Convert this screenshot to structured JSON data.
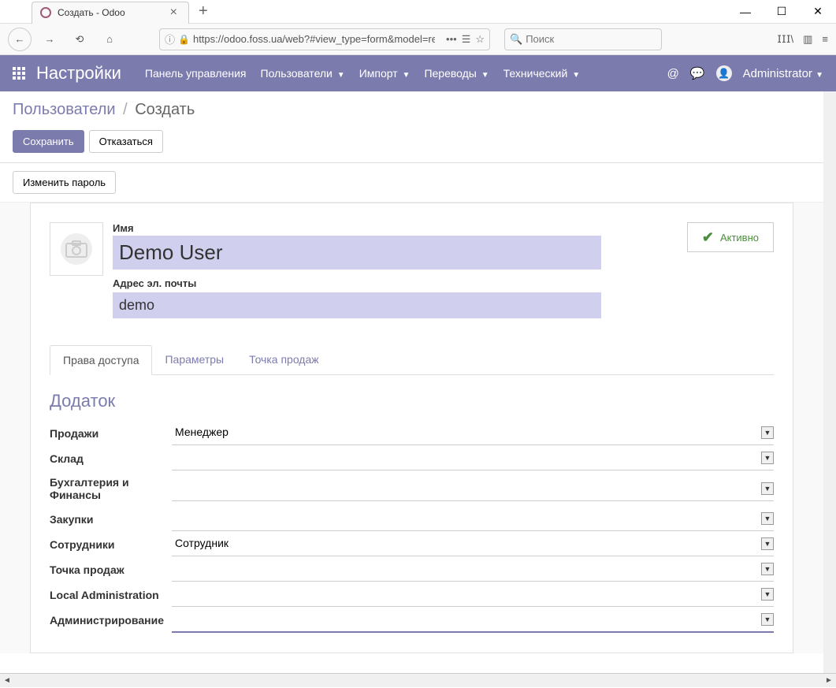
{
  "browser": {
    "tab_title": "Создать - Odoo",
    "url_display": "https://odoo.foss.ua/web?#view_type=form&model=res",
    "search_placeholder": "Поиск"
  },
  "navbar": {
    "app_title": "Настройки",
    "menu": {
      "control_panel": "Панель управления",
      "users": "Пользователи",
      "import": "Импорт",
      "translations": "Переводы",
      "technical": "Технический"
    },
    "user": "Administrator"
  },
  "breadcrumb": {
    "parent": "Пользователи",
    "current": "Создать"
  },
  "buttons": {
    "save": "Сохранить",
    "discard": "Отказаться",
    "change_password": "Изменить пароль"
  },
  "form": {
    "name_label": "Имя",
    "name_value": "Demo User",
    "email_label": "Адрес эл. почты",
    "email_value": "demo",
    "active_label": "Активно"
  },
  "tabs": {
    "access": "Права доступа",
    "params": "Параметры",
    "pos": "Точка продаж"
  },
  "section_title": "Додаток",
  "fields": {
    "sales": {
      "label": "Продажи",
      "value": "Менеджер"
    },
    "warehouse": {
      "label": "Склад",
      "value": ""
    },
    "accounting": {
      "label": "Бухгалтерия и Финансы",
      "value": ""
    },
    "purchases": {
      "label": "Закупки",
      "value": ""
    },
    "employees": {
      "label": "Сотрудники",
      "value": "Сотрудник"
    },
    "pos": {
      "label": "Точка продаж",
      "value": ""
    },
    "local_admin": {
      "label": "Local Administration",
      "value": ""
    },
    "admin": {
      "label": "Администрирование",
      "value": ""
    }
  }
}
